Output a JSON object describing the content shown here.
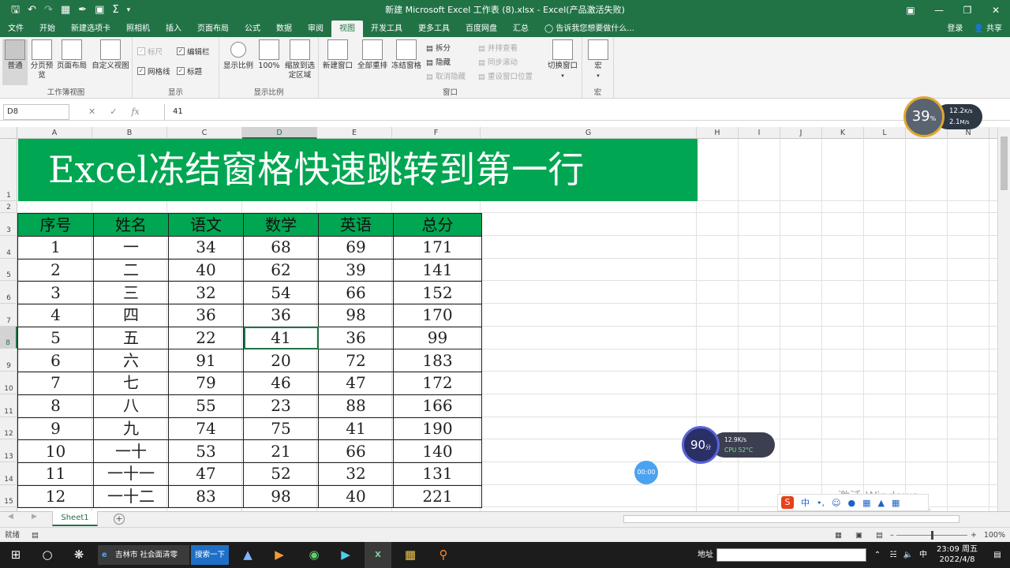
{
  "window": {
    "title": "新建 Microsoft Excel 工作表 (8).xlsx - Excel(产品激活失败)"
  },
  "tabs": [
    "文件",
    "开始",
    "新建选项卡",
    "照相机",
    "插入",
    "页面布局",
    "公式",
    "数据",
    "审阅",
    "视图",
    "开发工具",
    "更多工具",
    "百度网盘",
    "汇总"
  ],
  "active_tab": "视图",
  "tell_me": "告诉我您想要做什么...",
  "account": {
    "login": "登录",
    "share": "共享"
  },
  "ribbon": {
    "workbook_views": {
      "label": "工作簿视图",
      "normal": "普通",
      "page_break": "分页预览",
      "page_layout": "页面布局",
      "custom": "自定义视图"
    },
    "show": {
      "label": "显示",
      "ruler": "标尺",
      "formula_bar": "编辑栏",
      "gridlines": "网格线",
      "headings": "标题"
    },
    "zoom": {
      "label": "显示比例",
      "zoom": "显示比例",
      "hundred": "100%",
      "to_selection": "缩放到选定区域"
    },
    "window": {
      "label": "窗口",
      "new_window": "新建窗口",
      "arrange_all": "全部重排",
      "freeze": "冻结窗格",
      "split": "拆分",
      "hide": "隐藏",
      "unhide": "取消隐藏",
      "side_by_side": "并排查看",
      "sync_scroll": "同步滚动",
      "reset_pos": "重设窗口位置",
      "switch": "切换窗口"
    },
    "macros": {
      "label": "宏",
      "macros": "宏"
    }
  },
  "formula_bar": {
    "name_box": "D8",
    "value": "41"
  },
  "columns": [
    "A",
    "B",
    "C",
    "D",
    "E",
    "F",
    "G",
    "H",
    "I",
    "J",
    "K",
    "L",
    "M",
    "N"
  ],
  "rows": [
    "1",
    "2",
    "3",
    "4",
    "5",
    "6",
    "7",
    "8",
    "9",
    "10",
    "11",
    "12",
    "13",
    "14",
    "15"
  ],
  "banner": "Excel冻结窗格快速跳转到第一行",
  "table": {
    "headers": [
      "序号",
      "姓名",
      "语文",
      "数学",
      "英语",
      "总分"
    ],
    "rows": [
      [
        "1",
        "一",
        "34",
        "68",
        "69",
        "171"
      ],
      [
        "2",
        "二",
        "40",
        "62",
        "39",
        "141"
      ],
      [
        "3",
        "三",
        "32",
        "54",
        "66",
        "152"
      ],
      [
        "4",
        "四",
        "36",
        "36",
        "98",
        "170"
      ],
      [
        "5",
        "五",
        "22",
        "41",
        "36",
        "99"
      ],
      [
        "6",
        "六",
        "91",
        "20",
        "72",
        "183"
      ],
      [
        "7",
        "七",
        "79",
        "46",
        "47",
        "172"
      ],
      [
        "8",
        "八",
        "55",
        "23",
        "88",
        "166"
      ],
      [
        "9",
        "九",
        "74",
        "75",
        "41",
        "190"
      ],
      [
        "10",
        "一十",
        "53",
        "21",
        "66",
        "140"
      ],
      [
        "11",
        "一十一",
        "47",
        "52",
        "32",
        "131"
      ],
      [
        "12",
        "一十二",
        "83",
        "98",
        "40",
        "221"
      ]
    ]
  },
  "sheet_tab": "Sheet1",
  "status": {
    "ready": "就绪",
    "zoom": "100%"
  },
  "overlays": {
    "net1_percent": "39",
    "net1_unit": "%",
    "net1_up": "12.2",
    "net1_up_unit": "K/s",
    "net1_down": "2.1",
    "net1_down_unit": "M/s",
    "net2_score": "90",
    "net2_score_unit": "分",
    "net2_speed": "12.9K/s",
    "net2_cpu": "CPU 52°C",
    "timer": "00:00",
    "watermark": "激活 Windows",
    "watermark_sub": "转到\"设置\"以激活 Windows。"
  },
  "taskbar": {
    "ie_title": "吉林市 社会面清零",
    "search": "搜索一下",
    "address_label": "地址",
    "ime": "中",
    "time": "23:09 周五",
    "date": "2022/4/8"
  },
  "colors": {
    "excel_green": "#217346",
    "banner_green": "#00a651"
  }
}
